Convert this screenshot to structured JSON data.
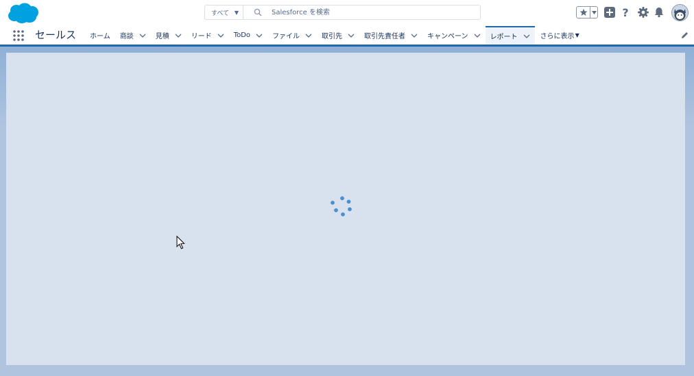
{
  "header": {
    "logo_name": "salesforce-cloud-logo",
    "search": {
      "scope_label": "すべて",
      "placeholder": "Salesforce を検索"
    },
    "icons": [
      "favorites-star-icon",
      "global-actions-plus-icon",
      "help-icon",
      "setup-gear-icon",
      "notifications-bell-icon",
      "user-avatar"
    ]
  },
  "context_bar": {
    "app_name": "セールス",
    "nav": [
      {
        "label": "ホーム",
        "has_menu": false
      },
      {
        "label": "商談",
        "has_menu": true
      },
      {
        "label": "見積",
        "has_menu": true
      },
      {
        "label": "リード",
        "has_menu": true
      },
      {
        "label": "ToDo",
        "has_menu": true
      },
      {
        "label": "ファイル",
        "has_menu": true
      },
      {
        "label": "取引先",
        "has_menu": true
      },
      {
        "label": "取引先責任者",
        "has_menu": true
      },
      {
        "label": "キャンペーン",
        "has_menu": true
      },
      {
        "label": "レポート",
        "has_menu": true,
        "active": true
      }
    ],
    "more_label": "さらに表示"
  },
  "main": {
    "state": "loading",
    "spinner_icon": "loading-spinner-icon"
  },
  "colors": {
    "brand": "#00a1e0",
    "nav_accent": "#1f67a8",
    "panel": "#d8e1ee",
    "spinner": "#4a90d0"
  }
}
